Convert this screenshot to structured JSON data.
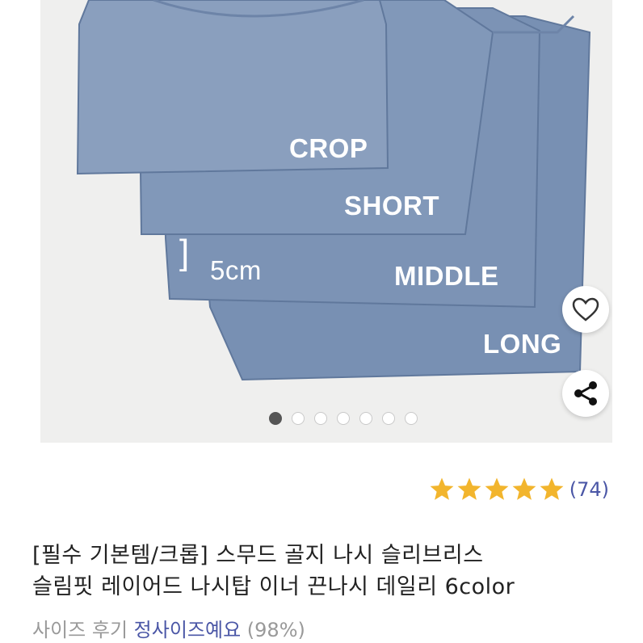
{
  "product_image": {
    "labels": {
      "crop": "CROP",
      "short": "SHORT",
      "middle": "MIDDLE",
      "long": "LONG",
      "measure": "5cm",
      "bracket": "]"
    },
    "carousel": {
      "total": 7,
      "active_index": 0
    }
  },
  "actions": {
    "wishlist_icon": "heart-icon",
    "share_icon": "share-icon"
  },
  "rating": {
    "stars": 5,
    "count_text": "(74)",
    "star_color": "#f2b52d"
  },
  "product": {
    "title_line1": "[필수 기본템/크롭] 스무드 골지 나시 슬리브리스",
    "title_line2": "슬림핏 레이어드 나시탑 이너 끈나시 데일리 6color"
  },
  "size_review": {
    "label": "사이즈 후기",
    "value": "정사이즈예요",
    "percent": "(98%)"
  },
  "colors": {
    "fabric": "#7b92b4",
    "accent": "#4a56a6"
  }
}
